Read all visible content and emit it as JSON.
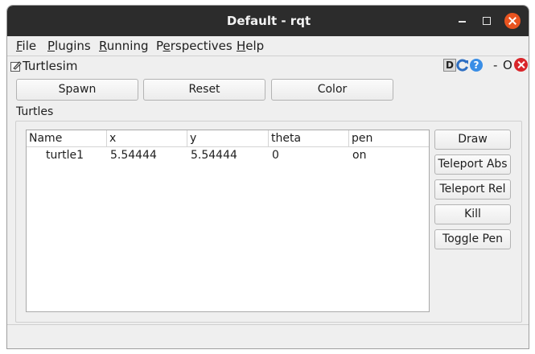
{
  "window": {
    "title": "Default - rqt"
  },
  "menu": {
    "file": {
      "mnemonic": "F",
      "rest": "ile"
    },
    "plugins": {
      "mnemonic": "P",
      "rest": "lugins"
    },
    "running": {
      "mnemonic": "R",
      "rest": "unning"
    },
    "perspectives": {
      "pre": "P",
      "mnemonic": "e",
      "rest": "rspectives"
    },
    "help": {
      "mnemonic": "H",
      "rest": "elp"
    }
  },
  "plugin": {
    "title": "Turtlesim",
    "tools": {
      "d_label": "D",
      "hide_label": "-",
      "float_label": "O"
    }
  },
  "top_buttons": {
    "spawn": "Spawn",
    "reset": "Reset",
    "color": "Color"
  },
  "turtles": {
    "group_label": "Turtles",
    "columns": [
      "Name",
      "x",
      "y",
      "theta",
      "pen"
    ],
    "rows": [
      {
        "name": "turtle1",
        "x": "5.54444",
        "y": "5.54444",
        "theta": "0",
        "pen": "on"
      }
    ]
  },
  "side_buttons": {
    "draw": "Draw",
    "teleport_abs": "Teleport Abs",
    "teleport_rel": "Teleport Rel",
    "kill": "Kill",
    "toggle_pen": "Toggle Pen"
  },
  "colors": {
    "titlebar": "#2c2c2c",
    "close": "#e95420",
    "background": "#efefef"
  }
}
